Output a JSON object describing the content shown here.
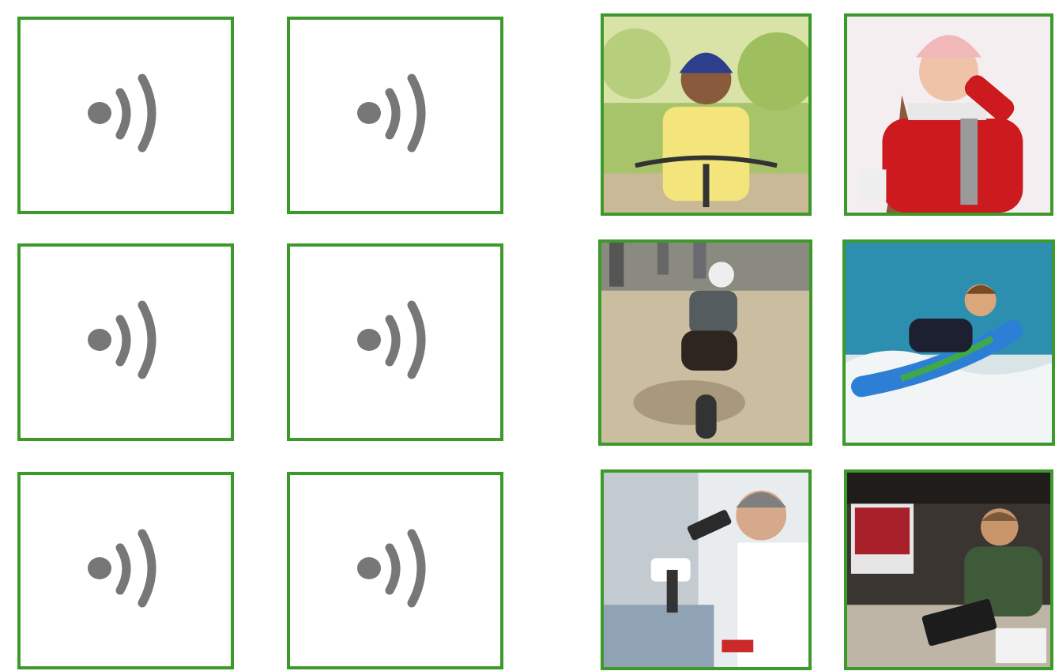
{
  "accent_color": "#3c9a2a",
  "icon_color": "#777777",
  "audio_cards": [
    {
      "icon": "speaker-sound-icon"
    },
    {
      "icon": "speaker-sound-icon"
    },
    {
      "icon": "speaker-sound-icon"
    },
    {
      "icon": "speaker-sound-icon"
    },
    {
      "icon": "speaker-sound-icon"
    },
    {
      "icon": "speaker-sound-icon"
    }
  ],
  "image_cards": [
    {
      "subject": "boy-riding-bicycle"
    },
    {
      "subject": "woman-in-winter-scarf"
    },
    {
      "subject": "boy-skateboarding"
    },
    {
      "subject": "boy-bodyboarding"
    },
    {
      "subject": "scientist-with-microscope"
    },
    {
      "subject": "man-with-drawing-tablet"
    }
  ]
}
